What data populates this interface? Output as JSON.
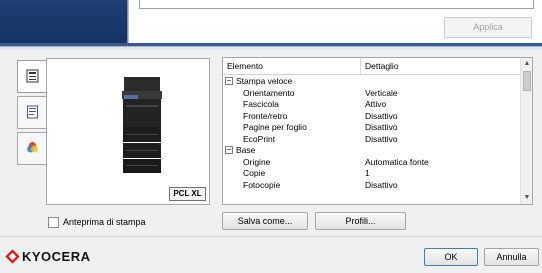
{
  "top": {
    "apply_label": "Applica"
  },
  "tabs": [
    {
      "icon": "printer-settings-icon"
    },
    {
      "icon": "document-icon"
    },
    {
      "icon": "color-icon"
    }
  ],
  "preview": {
    "badge": "PCL XL"
  },
  "grid": {
    "headers": [
      "Elemento",
      "Dettaglio"
    ],
    "rows": [
      {
        "type": "group",
        "toggle": "−",
        "key": "Stampa veloce",
        "value": ""
      },
      {
        "type": "item",
        "key": "Orientamento",
        "value": "Verticale"
      },
      {
        "type": "item",
        "key": "Fascicola",
        "value": "Attivo"
      },
      {
        "type": "item",
        "key": "Fronte/retro",
        "value": "Disattivo"
      },
      {
        "type": "item",
        "key": "Pagine per foglio",
        "value": "Disattivo"
      },
      {
        "type": "item",
        "key": "EcoPrint",
        "value": "Disattivo"
      },
      {
        "type": "group",
        "toggle": "−",
        "key": "Base",
        "value": ""
      },
      {
        "type": "item",
        "key": "Origine",
        "value": "Automatica fonte"
      },
      {
        "type": "item",
        "key": "Copie",
        "value": "1"
      },
      {
        "type": "item",
        "key": "Fotocopie",
        "value": "Disattivo"
      }
    ]
  },
  "checkbox_label": "Anteprima di stampa",
  "buttons": {
    "save_as": "Salva come...",
    "profiles": "Profili...",
    "ok": "OK",
    "cancel": "Annulla"
  },
  "brand": "KYOCERA",
  "colors": {
    "banner": "#1f3f73",
    "brand_red": "#d41e20",
    "ok_border": "#3c7fb1"
  }
}
